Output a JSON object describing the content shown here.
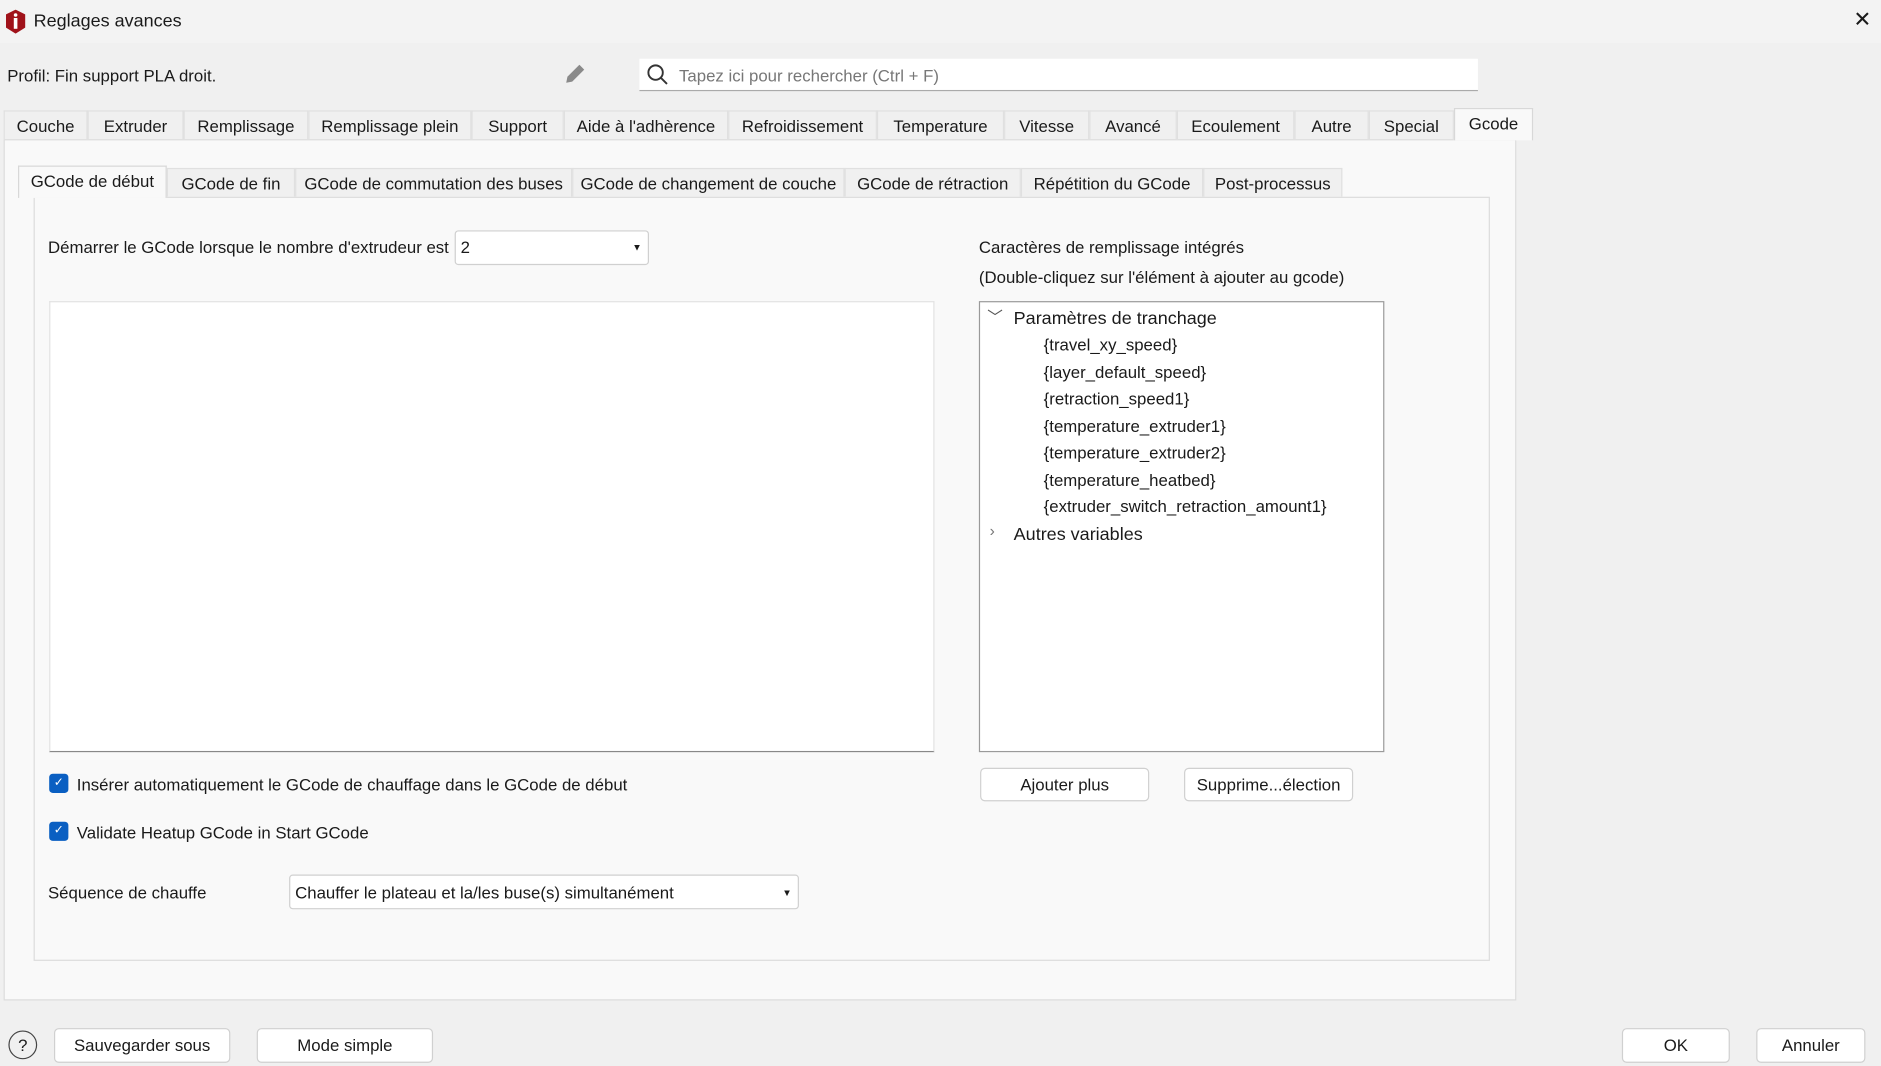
{
  "window": {
    "title": "Reglages avances",
    "close": "✕"
  },
  "profile": {
    "label": "Profil: Fin support PLA droit."
  },
  "search": {
    "placeholder": "Tapez ici pour rechercher (Ctrl + F)"
  },
  "tabs": [
    "Couche",
    "Extruder",
    "Remplissage",
    "Remplissage plein",
    "Support",
    "Aide à l'adhèrence",
    "Refroidissement",
    "Temperature",
    "Vitesse",
    "Avancé",
    "Ecoulement",
    "Autre",
    "Special",
    "Gcode"
  ],
  "subtabs": [
    "GCode de début",
    "GCode de fin",
    "GCode de commutation des buses",
    "GCode de changement de couche",
    "GCode de rétraction",
    "Répétition du GCode",
    "Post-processus"
  ],
  "start": {
    "label": "Démarrer le GCode lorsque le nombre d'extrudeur est",
    "value": "2"
  },
  "placeholders": {
    "title": "Caractères de remplissage intégrés",
    "hint": "(Double-cliquez sur l'élément à ajouter au gcode)",
    "group1": "Paramètres de tranchage",
    "items": [
      "{travel_xy_speed}",
      "{layer_default_speed}",
      "{retraction_speed1}",
      "{temperature_extruder1}",
      "{temperature_extruder2}",
      "{temperature_heatbed}",
      "{extruder_switch_retraction_amount1}"
    ],
    "group2": "Autres variables",
    "add": "Ajouter plus",
    "remove": "Supprime...élection"
  },
  "options": {
    "auto_heat": "Insérer automatiquement le GCode de chauffage dans le GCode de début",
    "validate": "Validate Heatup GCode in Start GCode",
    "sequence_label": "Séquence de chauffe",
    "sequence_value": "Chauffer le plateau et la/les buse(s) simultanément"
  },
  "footer": {
    "help": "?",
    "save_as": "Sauvegarder sous",
    "simple": "Mode simple",
    "ok": "OK",
    "cancel": "Annuler"
  }
}
